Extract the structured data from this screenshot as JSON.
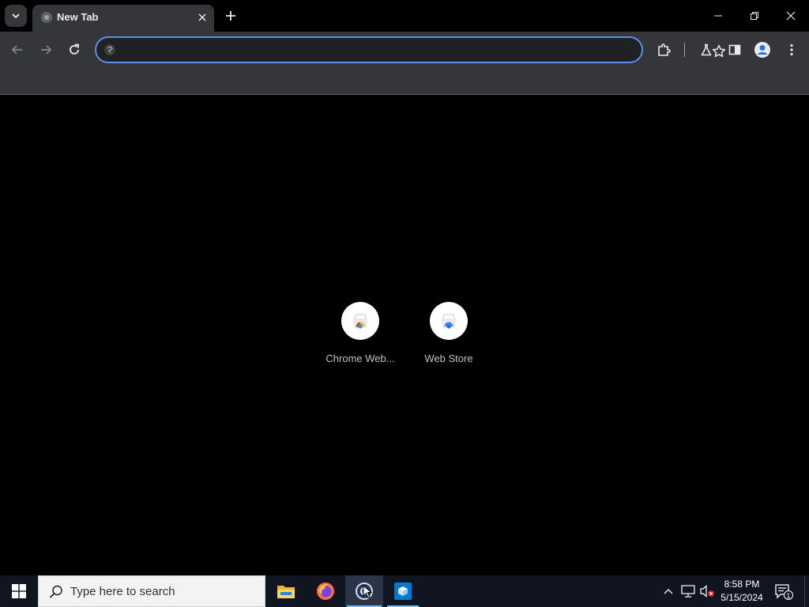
{
  "browser": {
    "tab": {
      "title": "New Tab"
    },
    "omnibox": {
      "value": "",
      "placeholder": ""
    }
  },
  "shortcuts": [
    {
      "label": "Chrome Web...",
      "icon": "chrome-web-store-icon"
    },
    {
      "label": "Web Store",
      "icon": "web-store-icon"
    }
  ],
  "taskbar": {
    "search_placeholder": "Type here to search",
    "apps": [
      "file-explorer-icon",
      "firefox-icon",
      "chrome-icon",
      "sandbox-app-icon"
    ],
    "clock": {
      "time": "8:58 PM",
      "date": "5/15/2024"
    },
    "notification_count": "1"
  },
  "colors": {
    "tab_bg": "#35363a",
    "omnibox_focus": "#5f8ee8",
    "taskbar": "#101521"
  }
}
